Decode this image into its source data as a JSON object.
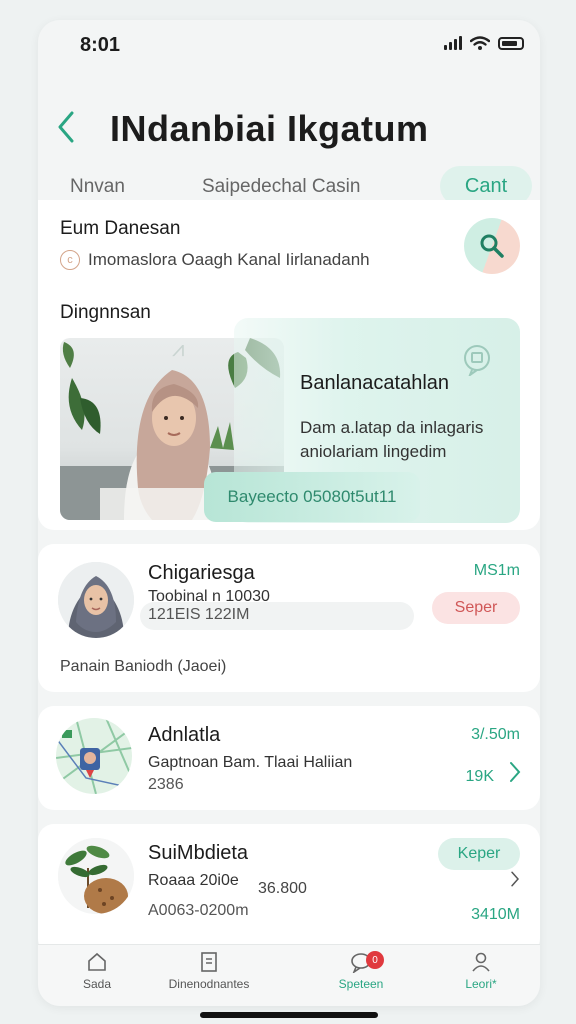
{
  "status": {
    "time": "8:01"
  },
  "header": {
    "title": "INdanbiai Ikgatum",
    "tabs": [
      "Nnvan",
      "Saipedechal Casin"
    ],
    "active_tab": "Cant"
  },
  "main": {
    "heading": "Eum Danesan",
    "subtitle": "Imomaslora Oaagh Kanal Iirlanadanh",
    "section_label": "Dingnnsan",
    "overlay_title": "Banlanacatahlan",
    "overlay_body": "Dam a.latap da inlagaris aniolariam lingedim",
    "overlay_button": "Bayeecto 05080t5ut11"
  },
  "list": [
    {
      "title": "Chigariesga",
      "line1": "Toobinal n 10030",
      "line2": "121EIS 122IM",
      "price": "MS1m",
      "badge": "Seper",
      "footer": "Panain Baniodh (Jaoei)"
    },
    {
      "title": "Adnlatla",
      "line1": "Gaptnoan Bam. Tlaai Haliian",
      "line2": "2386",
      "price": "3/.50m",
      "price2": "19K"
    },
    {
      "title": "SuiMbdieta",
      "line1": "Roaaa 20i0e",
      "line1b": "36.800",
      "line2": "A0063-0200m",
      "badge": "Keper",
      "price": "3410M"
    }
  ],
  "tabbar": {
    "items": [
      "Sada",
      "Dinenodnantes",
      "Speteen",
      "Leori*"
    ],
    "active_index": 2,
    "notif_count": "0"
  },
  "colors": {
    "accent": "#2aa683",
    "danger": "#d05757",
    "background": "#f3f5f5"
  }
}
